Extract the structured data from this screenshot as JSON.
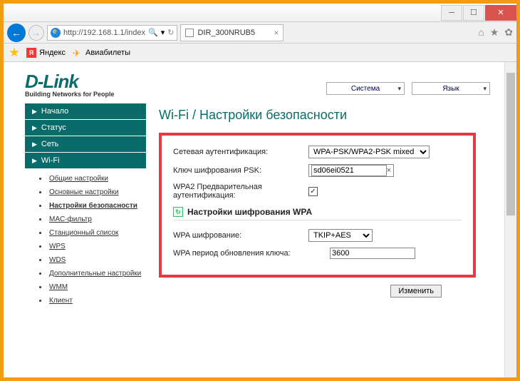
{
  "window": {
    "close_glyph": "✕"
  },
  "browser": {
    "url": "http://192.168.1.1/index",
    "search_glyph": "🔍",
    "refresh_glyph": "↻",
    "tab_title": "DIR_300NRUB5",
    "home_glyph": "⌂",
    "star_glyph": "★",
    "gear_glyph": "✿"
  },
  "favorites": {
    "yandex": "Яндекс",
    "avia": "Авиабилеты"
  },
  "logo": {
    "brand": "D-Link",
    "tagline": "Building Networks for People"
  },
  "top_menu": {
    "system": "Система",
    "language": "Язык"
  },
  "sidebar": {
    "items": [
      {
        "label": "Начало"
      },
      {
        "label": "Статус"
      },
      {
        "label": "Сеть"
      },
      {
        "label": "Wi-Fi"
      }
    ],
    "sub": [
      {
        "label": "Общие настройки"
      },
      {
        "label": "Основные настройки"
      },
      {
        "label": "Настройки безопасности"
      },
      {
        "label": "MAC-фильтр"
      },
      {
        "label": "Станционный список"
      },
      {
        "label": "WPS"
      },
      {
        "label": "WDS"
      },
      {
        "label": "Дополнительные настройки"
      },
      {
        "label": "WMM"
      },
      {
        "label": "Клиент"
      }
    ]
  },
  "crumb": {
    "text": "Wi-Fi  /  Настройки безопасности"
  },
  "form": {
    "auth_label": "Сетевая аутентификация:",
    "auth_value": "WPA-PSK/WPA2-PSK mixed",
    "psk_label": "Ключ шифрования PSK:",
    "psk_value": "sd06ei0521",
    "preauth_label": "WPA2 Предварительная аутентификация:",
    "preauth_checked_glyph": "✓",
    "section_title": "Настройки шифрования WPA",
    "enc_label": "WPA шифрование:",
    "enc_value": "TKIP+AES",
    "period_label": "WPA период обновления ключа:",
    "period_value": "3600"
  },
  "buttons": {
    "apply": "Изменить"
  }
}
